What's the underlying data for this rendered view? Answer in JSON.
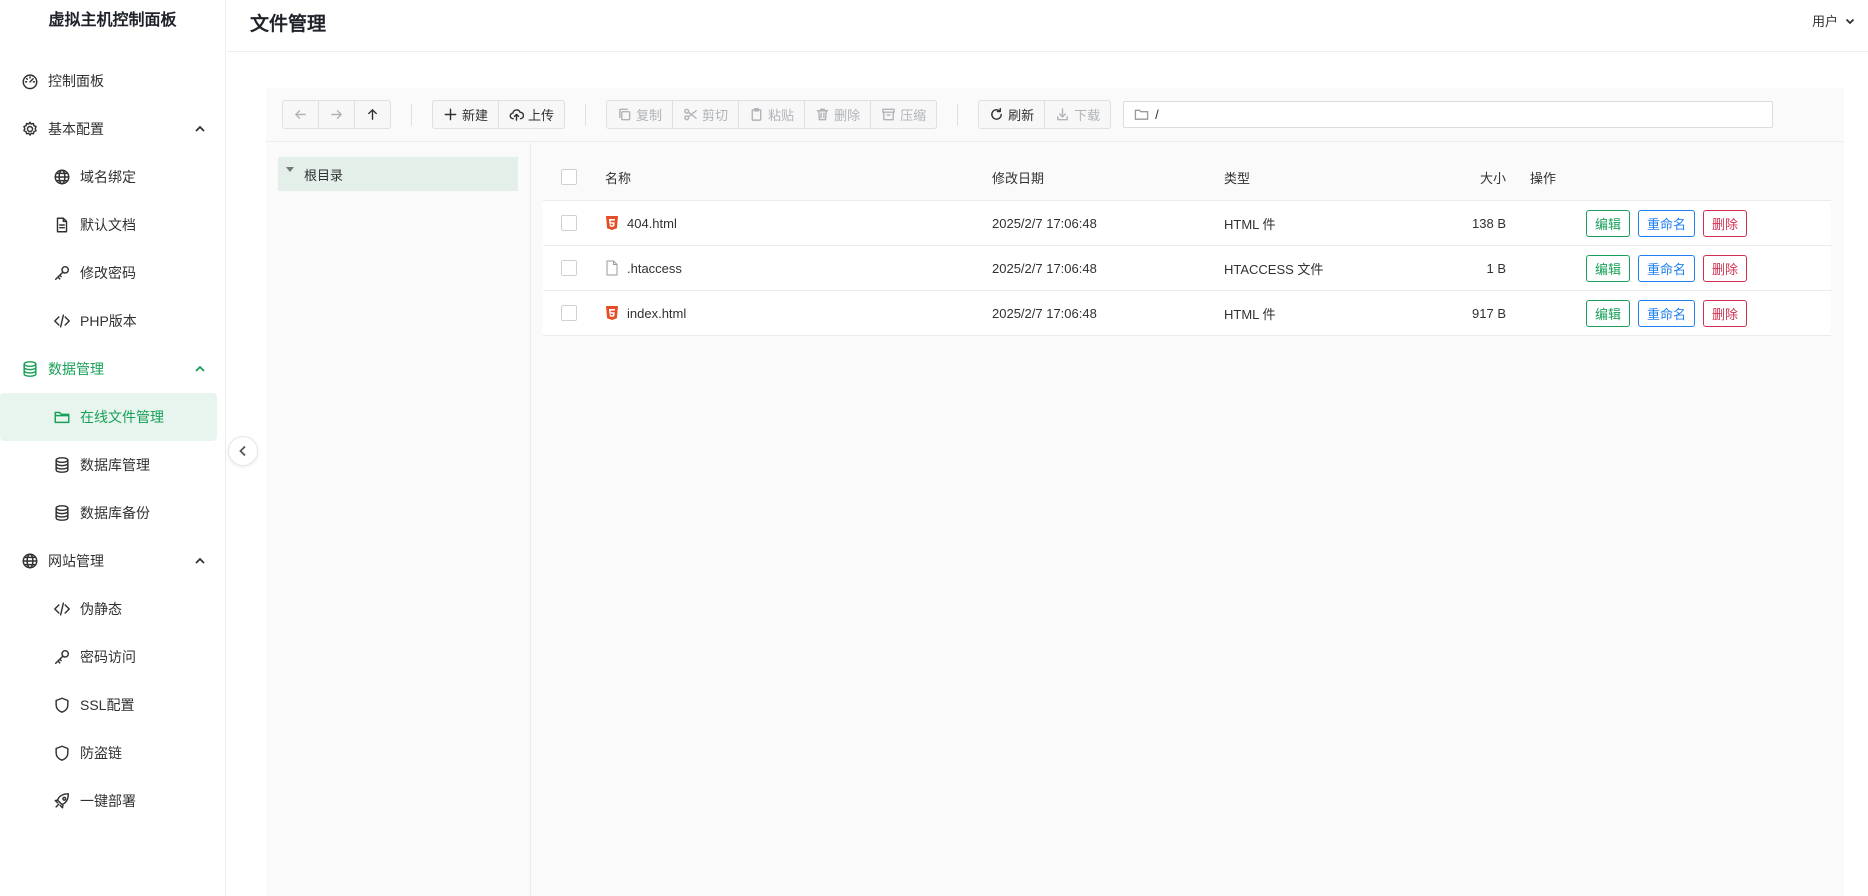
{
  "sidebar": {
    "title": "虚拟主机控制面板",
    "items": [
      {
        "label": "控制面板"
      },
      {
        "label": "基本配置"
      },
      {
        "label": "域名绑定"
      },
      {
        "label": "默认文档"
      },
      {
        "label": "修改密码"
      },
      {
        "label": "PHP版本"
      },
      {
        "label": "数据管理"
      },
      {
        "label": "在线文件管理"
      },
      {
        "label": "数据库管理"
      },
      {
        "label": "数据库备份"
      },
      {
        "label": "网站管理"
      },
      {
        "label": "伪静态"
      },
      {
        "label": "密码访问"
      },
      {
        "label": "SSL配置"
      },
      {
        "label": "防盗链"
      },
      {
        "label": "一键部署"
      }
    ]
  },
  "header": {
    "title": "文件管理",
    "user": "用户"
  },
  "toolbar": {
    "new": "新建",
    "upload": "上传",
    "copy": "复制",
    "cut": "剪切",
    "paste": "粘贴",
    "delete": "删除",
    "compress": "压缩",
    "refresh": "刷新",
    "download": "下载",
    "path": "/"
  },
  "tree": {
    "root": "根目录"
  },
  "table": {
    "headers": {
      "name": "名称",
      "date": "修改日期",
      "type": "类型",
      "size": "大小",
      "ops": "操作"
    },
    "rows": [
      {
        "name": "404.html",
        "date": "2025/2/7 17:06:48",
        "type": "HTML 件",
        "size": "138 B",
        "icon": "html5-icon"
      },
      {
        "name": ".htaccess",
        "date": "2025/2/7 17:06:48",
        "type": "HTACCESS 文件",
        "size": "1 B",
        "icon": "file-icon"
      },
      {
        "name": "index.html",
        "date": "2025/2/7 17:06:48",
        "type": "HTML 件",
        "size": "917 B",
        "icon": "html5-icon"
      }
    ],
    "actions": {
      "edit": "编辑",
      "rename": "重命名",
      "delete": "删除"
    }
  },
  "colors": {
    "accent": "#18a058",
    "info": "#2080f0",
    "danger": "#d03050",
    "html5": "#e44d26"
  }
}
